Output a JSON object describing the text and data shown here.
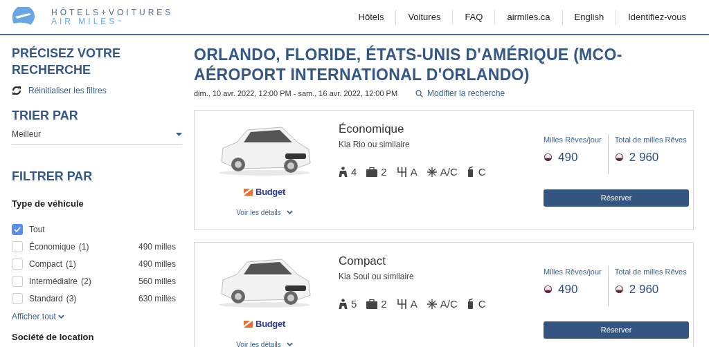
{
  "header": {
    "logo_line1": "HÔTELS+VOITURES",
    "logo_line2": "AIR MILES",
    "logo_tm": "™",
    "nav": [
      {
        "label": "Hôtels"
      },
      {
        "label": "Voitures"
      },
      {
        "label": "FAQ"
      },
      {
        "label": "airmiles.ca"
      },
      {
        "label": "English"
      },
      {
        "label": "Identifiez-vous"
      }
    ]
  },
  "sidebar": {
    "title": "PRÉCISEZ VOTRE RECHERCHE",
    "reset": "Réinitialiser les filtres",
    "sort_title": "TRIER PAR",
    "sort_value": "Meilleur",
    "filter_title": "FILTRER PAR",
    "vehicle_type_title": "Type de véhicule",
    "vehicle_types": [
      {
        "label": "Tout",
        "checked": true
      },
      {
        "label": "Économique",
        "count": "(1)",
        "miles": "490 milles",
        "checked": false
      },
      {
        "label": "Compact",
        "count": "(1)",
        "miles": "490 milles",
        "checked": false
      },
      {
        "label": "Intermédiaire",
        "count": "(2)",
        "miles": "560 milles",
        "checked": false
      },
      {
        "label": "Standard",
        "count": "(3)",
        "miles": "630 milles",
        "checked": false
      }
    ],
    "show_all": "Afficher tout",
    "next_section": "Société de location"
  },
  "results": {
    "title": "ORLANDO, FLORIDE, ÉTATS-UNIS D'AMÉRIQUE (MCO-AÉROPORT INTERNATIONAL D'ORLANDO)",
    "dates": "dim., 10 avr. 2022, 12:00 PM - sam., 16 avr. 2022, 12:00 PM",
    "modify": "Modifier la recherche",
    "cars": [
      {
        "category": "Économique",
        "model": "Kia Rio ou similaire",
        "brand": "Budget",
        "details": "Voir les détails",
        "features": [
          {
            "kind": "passengers",
            "value": "4"
          },
          {
            "kind": "bags",
            "value": "2"
          },
          {
            "kind": "transmission",
            "value": "A"
          },
          {
            "kind": "ac",
            "value": "A/C"
          },
          {
            "kind": "fuel",
            "value": "C"
          }
        ],
        "per_day_label": "Milles Rêves/jour",
        "per_day": "490",
        "total_label": "Total de milles Rêves",
        "total": "2 960",
        "book": "Réserver"
      },
      {
        "category": "Compact",
        "model": "Kia Soul ou similaire",
        "brand": "Budget",
        "details": "Voir les détails",
        "features": [
          {
            "kind": "passengers",
            "value": "5"
          },
          {
            "kind": "bags",
            "value": "2"
          },
          {
            "kind": "transmission",
            "value": "A"
          },
          {
            "kind": "ac",
            "value": "A/C"
          },
          {
            "kind": "fuel",
            "value": "C"
          }
        ],
        "per_day_label": "Milles Rêves/jour",
        "per_day": "490",
        "total_label": "Total de milles Rêves",
        "total": "2 960",
        "book": "Réserver"
      }
    ]
  }
}
